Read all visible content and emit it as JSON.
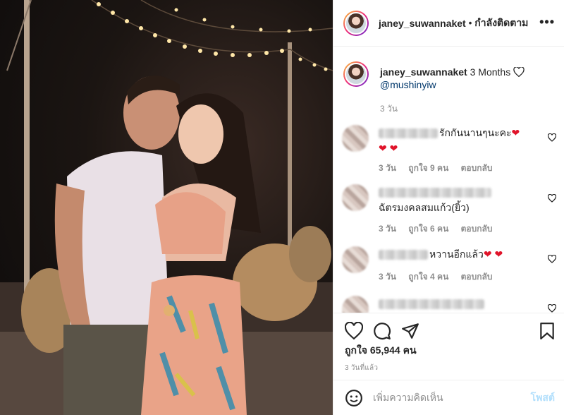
{
  "post": {
    "username": "janey_suwannaket",
    "separator": "•",
    "follow_status": "กำลังติดตาม",
    "more_label": "•••"
  },
  "caption": {
    "username": "janey_suwannaket",
    "text": "3 Months",
    "mention": "@mushinyiw",
    "time": "3 วัน"
  },
  "comments": [
    {
      "text": "รักกันนานๆนะคะ",
      "emoji": "❤",
      "emoji_line2": "❤ ❤",
      "time": "3 วัน",
      "likes": "ถูกใจ 9 คน",
      "reply": "ตอบกลับ"
    },
    {
      "text": "ฉัตรมงคลสมแก้ว(ยิ้ว)",
      "time": "3 วัน",
      "likes": "ถูกใจ 6 คน",
      "reply": "ตอบกลับ"
    },
    {
      "text": "หวานอีกแล้ว",
      "emoji": "❤ ❤",
      "time": "3 วัน",
      "likes": "ถูกใจ 4 คน",
      "reply": "ตอบกลับ"
    },
    {
      "text": ""
    }
  ],
  "actions": {
    "likes_count": "ถูกใจ 65,944 คน",
    "time_ago": "3 วันที่แล้ว"
  },
  "add_comment": {
    "placeholder": "เพิ่มความคิดเห็น",
    "post_label": "โพสต์"
  },
  "colors": {
    "link": "#00376b",
    "muted": "#8e8e8e",
    "heart": "#e0142a",
    "post_disabled": "#b2dffc"
  }
}
